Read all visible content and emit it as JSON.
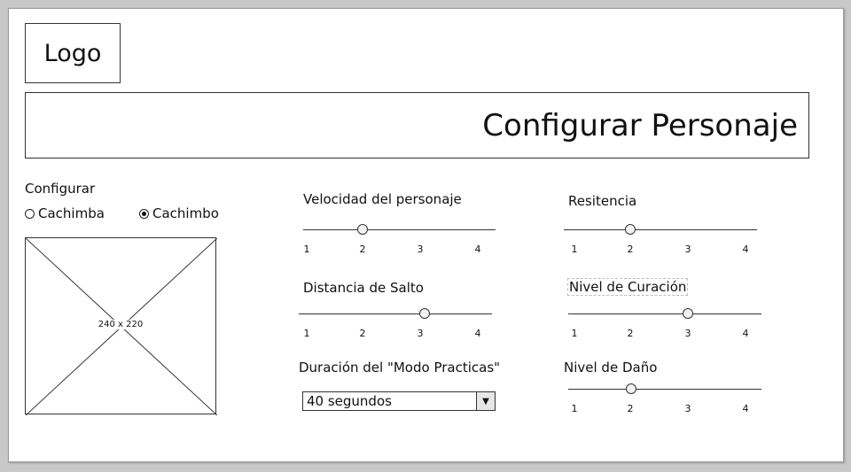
{
  "header": {
    "logo": "Logo",
    "title": "Configurar Personaje"
  },
  "left": {
    "configure_label": "Configurar",
    "radios": [
      {
        "label": "Cachimba",
        "selected": false
      },
      {
        "label": "Cachimbo",
        "selected": true
      }
    ],
    "image_placeholder": "240 x 220"
  },
  "sliders": {
    "velocidad": {
      "label": "Velocidad del personaje",
      "ticks": [
        "1",
        "2",
        "3",
        "4"
      ],
      "value": 2
    },
    "distancia": {
      "label": "Distancia de Salto",
      "ticks": [
        "1",
        "2",
        "3",
        "4"
      ],
      "value": 3
    },
    "resistencia": {
      "label": "Resitencia",
      "ticks": [
        "1",
        "2",
        "3",
        "4"
      ],
      "value": 2
    },
    "curacion": {
      "label": "Nivel de Curación",
      "ticks": [
        "1",
        "2",
        "3",
        "4"
      ],
      "value": 3
    },
    "dano": {
      "label": "Nivel de Daño",
      "ticks": [
        "1",
        "2",
        "3",
        "4"
      ],
      "value": 2
    }
  },
  "duracion": {
    "label": "Duración del \"Modo Practicas\"",
    "selected": "40 segundos"
  }
}
